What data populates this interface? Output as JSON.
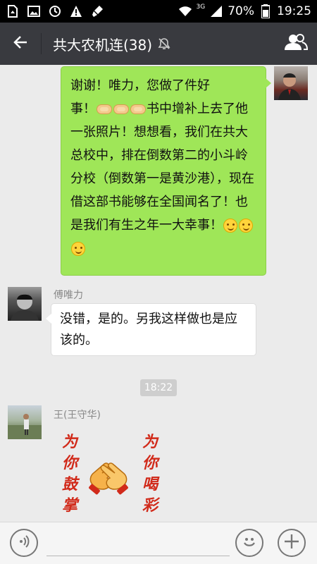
{
  "status_bar": {
    "network": "3G",
    "battery": "70%",
    "time": "19:25"
  },
  "header": {
    "title": "共大农机连(38)"
  },
  "messages": [
    {
      "sender": "me",
      "line1": "谢谢！唯力，您做了件好",
      "line2_prefix": "事！",
      "line2_suffix": "书中增补上去了",
      "rest": "他一张照片！想想看，我们在共大总校中，排在倒数第二的小斗岭分校（倒数第一是黄沙港），现在借这部书能够在全国闻名了！也是我们有生之年一大幸事！"
    },
    {
      "sender": "傅唯力",
      "text": "没错，是的。另我这样做也是应该的。"
    }
  ],
  "timestamp": "18:22",
  "sticker_message": {
    "sender": "王(王守华)",
    "left_text": [
      "为",
      "你",
      "鼓",
      "掌"
    ],
    "right_text": [
      "为",
      "你",
      "喝",
      "彩"
    ]
  },
  "input": {
    "placeholder": ""
  },
  "colors": {
    "header_bg": "#393a3f",
    "my_bubble": "#9fe658",
    "chat_bg": "#ebebeb"
  }
}
